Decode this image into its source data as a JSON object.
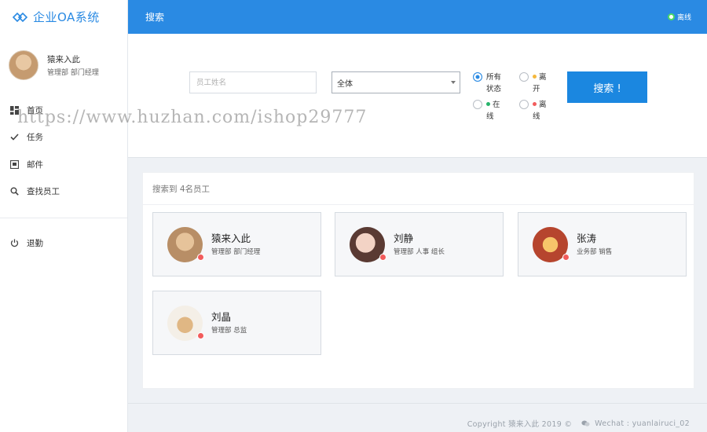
{
  "brand": {
    "name": "企业OA系统"
  },
  "user": {
    "name": "猿来入此",
    "dept": "管理部 部门经理"
  },
  "nav": {
    "items": [
      {
        "label": "首页",
        "icon": "dashboard-icon"
      },
      {
        "label": "任务",
        "icon": "check-icon"
      },
      {
        "label": "邮件",
        "icon": "inbox-icon"
      },
      {
        "label": "查找员工",
        "icon": "search-icon"
      }
    ],
    "logout": {
      "label": "退勤",
      "icon": "power-icon"
    }
  },
  "topbar": {
    "title": "搜索",
    "status": "离线",
    "status_color": "#4cd964"
  },
  "search": {
    "placeholder": "员工姓名",
    "select_value": "全体",
    "radios": [
      {
        "label": "所有状态",
        "checked": true,
        "dot_color": ""
      },
      {
        "label": "离开",
        "checked": false,
        "dot_color": "#f5b83d"
      },
      {
        "label": "在线",
        "checked": false,
        "dot_color": "#27b36b"
      },
      {
        "label": "离线",
        "checked": false,
        "dot_color": "#f25c5c"
      }
    ],
    "button_label": "搜索 !"
  },
  "results": {
    "summary": "搜索到 4名员工",
    "employees": [
      {
        "name": "猿来入此",
        "dept": "管理部 部门经理"
      },
      {
        "name": "刘静",
        "dept": "管理部 人事 组长"
      },
      {
        "name": "张涛",
        "dept": "业务部 销售"
      },
      {
        "name": "刘晶",
        "dept": "管理部 总监"
      }
    ]
  },
  "footer": {
    "copyright": "Copyright 猿来入此 2019 ©",
    "wechat": "Wechat : yuanlairuci_02"
  },
  "watermark": "https://www.huzhan.com/ishop29777",
  "colors": {
    "primary": "#2a8ae3",
    "button": "#1b87e0",
    "offline_badge": "#f25c5c"
  }
}
